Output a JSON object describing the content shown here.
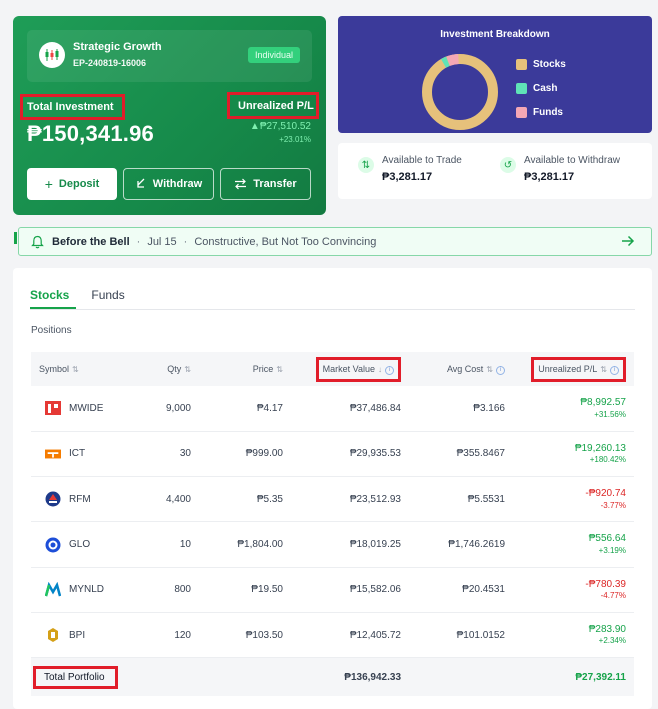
{
  "account": {
    "name": "Strategic Growth",
    "id": "EP-240819-16006",
    "type_badge": "Individual",
    "total_investment_label": "Total Investment",
    "total_investment_value": "₱150,341.96",
    "unrealized_label": "Unrealized P/L",
    "unrealized_value": "₱27,510.52",
    "unrealized_pct": "+23.01%",
    "buttons": {
      "deposit": "Deposit",
      "withdraw": "Withdraw",
      "transfer": "Transfer"
    }
  },
  "breakdown": {
    "title": "Investment Breakdown",
    "legend": [
      {
        "name": "Stocks",
        "color": "#e6c17b"
      },
      {
        "name": "Cash",
        "color": "#5fe3b7"
      },
      {
        "name": "Funds",
        "color": "#f4a7b5"
      }
    ]
  },
  "available": {
    "trade_label": "Available to Trade",
    "trade_value": "₱3,281.17",
    "withdraw_label": "Available to Withdraw",
    "withdraw_value": "₱3,281.17"
  },
  "news": {
    "title": "Before the Bell",
    "date": "Jul 15",
    "headline": "Constructive, But Not Too Convincing"
  },
  "tabs": [
    "Stocks",
    "Funds"
  ],
  "positions_label": "Positions",
  "columns": {
    "symbol": "Symbol",
    "qty": "Qty",
    "price": "Price",
    "market_value": "Market Value",
    "avg_cost": "Avg Cost",
    "unrealized": "Unrealized P/L"
  },
  "rows": [
    {
      "symbol": "MWIDE",
      "qty": "9,000",
      "price": "₱4.17",
      "market_value": "₱37,486.84",
      "avg_cost": "₱3.166",
      "pl": "₱8,992.57",
      "pl_pct": "+31.56%",
      "trend": "up"
    },
    {
      "symbol": "ICT",
      "qty": "30",
      "price": "₱999.00",
      "market_value": "₱29,935.53",
      "avg_cost": "₱355.8467",
      "pl": "₱19,260.13",
      "pl_pct": "+180.42%",
      "trend": "up"
    },
    {
      "symbol": "RFM",
      "qty": "4,400",
      "price": "₱5.35",
      "market_value": "₱23,512.93",
      "avg_cost": "₱5.5531",
      "pl": "-₱920.74",
      "pl_pct": "-3.77%",
      "trend": "down"
    },
    {
      "symbol": "GLO",
      "qty": "10",
      "price": "₱1,804.00",
      "market_value": "₱18,019.25",
      "avg_cost": "₱1,746.2619",
      "pl": "₱556.64",
      "pl_pct": "+3.19%",
      "trend": "up"
    },
    {
      "symbol": "MYNLD",
      "qty": "800",
      "price": "₱19.50",
      "market_value": "₱15,582.06",
      "avg_cost": "₱20.4531",
      "pl": "-₱780.39",
      "pl_pct": "-4.77%",
      "trend": "down"
    },
    {
      "symbol": "BPI",
      "qty": "120",
      "price": "₱103.50",
      "market_value": "₱12,405.72",
      "avg_cost": "₱101.0152",
      "pl": "₱283.90",
      "pl_pct": "+2.34%",
      "trend": "up"
    }
  ],
  "total": {
    "label": "Total Portfolio",
    "market_value": "₱136,942.33",
    "pl": "₱27,392.11"
  },
  "colors": {
    "brand_green": "#16a34a",
    "negative": "#dc2626",
    "breakdown_bg": "#3b3a9a",
    "highlight": "#e11d2a"
  }
}
